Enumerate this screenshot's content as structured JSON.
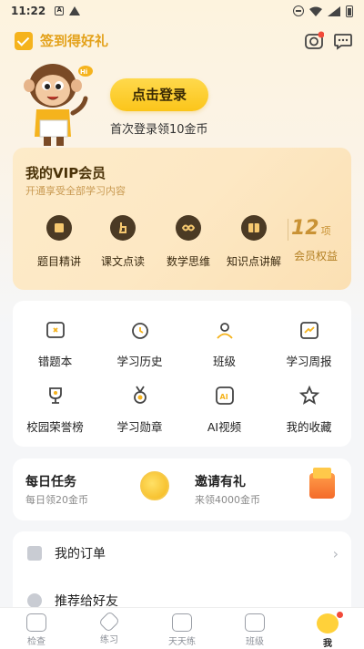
{
  "status_bar": {
    "time": "11:22"
  },
  "header": {
    "checkin_label": "签到得好礼"
  },
  "login": {
    "button_label": "点击登录",
    "hint": "首次登录领10金币"
  },
  "vip": {
    "title": "我的VIP会员",
    "subtitle": "开通享受全部学习内容",
    "items": [
      {
        "label": "题目精讲",
        "icon": "book-icon"
      },
      {
        "label": "课文点读",
        "icon": "finger-point-icon"
      },
      {
        "label": "数学思维",
        "icon": "infinity-icon"
      },
      {
        "label": "知识点讲解",
        "icon": "open-book-icon"
      }
    ],
    "count": "12",
    "count_unit": "项",
    "benefit_label": "会员权益"
  },
  "features": [
    {
      "label": "错题本",
      "icon": "wrong-book-icon"
    },
    {
      "label": "学习历史",
      "icon": "clock-icon"
    },
    {
      "label": "班级",
      "icon": "class-icon"
    },
    {
      "label": "学习周报",
      "icon": "report-icon"
    },
    {
      "label": "校园荣誉榜",
      "icon": "trophy-icon"
    },
    {
      "label": "学习勋章",
      "icon": "medal-icon"
    },
    {
      "label": "AI视频",
      "icon": "ai-icon"
    },
    {
      "label": "我的收藏",
      "icon": "star-icon"
    }
  ],
  "tasks": {
    "daily_title": "每日任务",
    "daily_sub": "每日领20金币",
    "invite_title": "邀请有礼",
    "invite_sub": "来领4000金币"
  },
  "list": [
    {
      "label": "我的订单"
    },
    {
      "label": "推荐给好友"
    }
  ],
  "nav": [
    {
      "label": "检查"
    },
    {
      "label": "练习"
    },
    {
      "label": "天天练"
    },
    {
      "label": "班级"
    },
    {
      "label": "我"
    }
  ],
  "colors": {
    "accent": "#fbc51a",
    "vip_text": "#c99234",
    "badge": "#f24a3a"
  }
}
